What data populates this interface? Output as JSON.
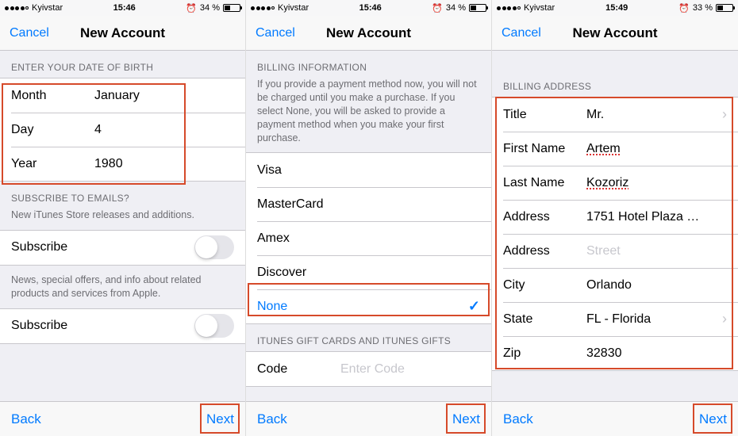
{
  "screens": [
    {
      "statusbar": {
        "carrier": "Kyivstar",
        "time": "15:46",
        "battery_pct": "34 %",
        "signal_filled": 4
      },
      "navbar": {
        "cancel": "Cancel",
        "title": "New Account"
      },
      "dob": {
        "header": "ENTER YOUR DATE OF BIRTH",
        "month_label": "Month",
        "month_value": "January",
        "day_label": "Day",
        "day_value": "4",
        "year_label": "Year",
        "year_value": "1980"
      },
      "emails": {
        "header": "SUBSCRIBE TO EMAILS?",
        "note1": "New iTunes Store releases and additions.",
        "sub1": "Subscribe",
        "note2": "News, special offers, and info about related products and services from Apple.",
        "sub2": "Subscribe"
      },
      "footer": {
        "back": "Back",
        "next": "Next"
      }
    },
    {
      "statusbar": {
        "carrier": "Kyivstar",
        "time": "15:46",
        "battery_pct": "34 %",
        "signal_filled": 4
      },
      "navbar": {
        "cancel": "Cancel",
        "title": "New Account"
      },
      "billing_info": {
        "header": "BILLING INFORMATION",
        "explain": "If you provide a payment method now, you will not be charged until you make a purchase. If you select None, you will be asked to provide a payment method when you make your first purchase."
      },
      "payment_methods": {
        "visa": "Visa",
        "mastercard": "MasterCard",
        "amex": "Amex",
        "discover": "Discover",
        "none": "None"
      },
      "gift": {
        "header": "ITUNES GIFT CARDS AND ITUNES GIFTS",
        "code_label": "Code",
        "code_placeholder": "Enter Code"
      },
      "footer": {
        "back": "Back",
        "next": "Next"
      }
    },
    {
      "statusbar": {
        "carrier": "Kyivstar",
        "time": "15:49",
        "battery_pct": "33 %",
        "signal_filled": 4
      },
      "navbar": {
        "cancel": "Cancel",
        "title": "New Account"
      },
      "billing_addr": {
        "header": "BILLING ADDRESS",
        "title_label": "Title",
        "title_value": "Mr.",
        "first_label": "First Name",
        "first_value": "Artem",
        "last_label": "Last Name",
        "last_value": "Kozoriz",
        "addr1_label": "Address",
        "addr1_value": "1751 Hotel Plaza …",
        "addr2_label": "Address",
        "addr2_placeholder": "Street",
        "city_label": "City",
        "city_value": "Orlando",
        "state_label": "State",
        "state_value": "FL - Florida",
        "zip_label": "Zip",
        "zip_value": "32830"
      },
      "footer": {
        "back": "Back",
        "next": "Next"
      }
    }
  ]
}
